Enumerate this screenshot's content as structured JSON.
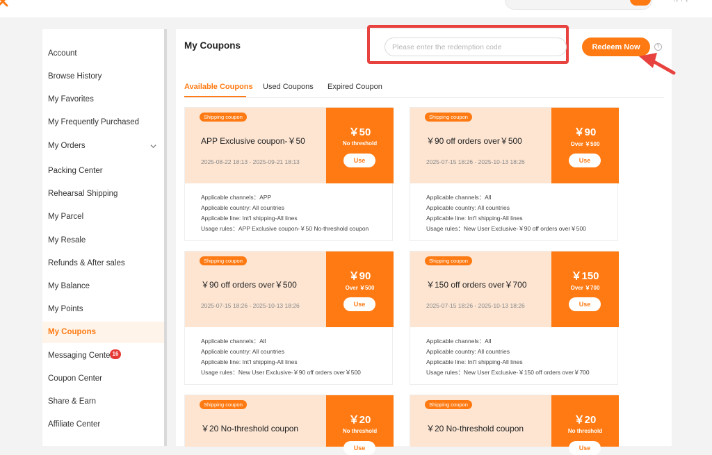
{
  "topbar": {
    "brand_icon": "logo-icon",
    "mini_text": "· · ↑↓ ↑ ↓"
  },
  "sidebar": {
    "items": [
      {
        "label": "Account"
      },
      {
        "label": "Browse History"
      },
      {
        "label": "My Favorites"
      },
      {
        "label": "My Frequently Purchased"
      },
      {
        "label": "My Orders",
        "has_chevron": true
      },
      {
        "label": "Packing Center"
      },
      {
        "label": "Rehearsal Shipping"
      },
      {
        "label": "My Parcel"
      },
      {
        "label": "My Resale"
      },
      {
        "label": "Refunds & After sales"
      },
      {
        "label": "My Balance"
      },
      {
        "label": "My Points"
      },
      {
        "label": "My Coupons",
        "active": true
      },
      {
        "label": "Messaging Center",
        "badge": "16"
      },
      {
        "label": "Coupon Center"
      },
      {
        "label": "Share & Earn"
      },
      {
        "label": "Affiliate Center"
      }
    ]
  },
  "main": {
    "title": "My Coupons",
    "redeem_placeholder": "Please enter the redemption code",
    "redeem_button": "Redeem Now",
    "help_symbol": "?",
    "tabs": [
      {
        "label": "Available Coupons",
        "active": true
      },
      {
        "label": "Used Coupons"
      },
      {
        "label": "Expired Coupon"
      }
    ],
    "coupons": [
      {
        "tag": "Shipping coupon",
        "title": "APP Exclusive coupon-￥50",
        "date": "2025-08-22 18:13 - 2025-09-21 18:13",
        "amount": "￥50",
        "condition": "No threshold",
        "use": "Use",
        "lines": [
          "Applicable channels：APP",
          "Applicable country: All countries",
          "Applicable line: Int'l shipping-All lines",
          "Usage rules：APP Exclusive coupon-￥50 No-threshold coupon"
        ]
      },
      {
        "tag": "Shipping coupon",
        "title": "￥90 off orders over￥500",
        "date": "2025-07-15 18:26 - 2025-10-13 18:26",
        "amount": "￥90",
        "condition": "Over ￥500",
        "use": "Use",
        "lines": [
          "Applicable channels：All",
          "Applicable country: All countries",
          "Applicable line: Int'l shipping-All lines",
          "Usage rules：New User Exclusive-￥90 off orders over￥500"
        ]
      },
      {
        "tag": "Shipping coupon",
        "title": "￥90 off orders over￥500",
        "date": "2025-07-15 18:26 - 2025-10-13 18:26",
        "amount": "￥90",
        "condition": "Over ￥500",
        "use": "Use",
        "lines": [
          "Applicable channels：All",
          "Applicable country: All countries",
          "Applicable line: Int'l shipping-All lines",
          "Usage rules：New User Exclusive-￥90 off orders over￥500"
        ]
      },
      {
        "tag": "Shipping coupon",
        "title": "￥150 off orders over￥700",
        "date": "2025-07-15 18:26 - 2025-10-13 18:26",
        "amount": "￥150",
        "condition": "Over ￥700",
        "use": "Use",
        "lines": [
          "Applicable channels：All",
          "Applicable country: All countries",
          "Applicable line: Int'l shipping-All lines",
          "Usage rules：New User Exclusive-￥150 off orders over￥700"
        ]
      },
      {
        "tag": "Shipping coupon",
        "title": "￥20 No-threshold coupon",
        "date": "",
        "amount": "￥20",
        "condition": "No threshold",
        "use": "Use",
        "lines": []
      },
      {
        "tag": "Shipping coupon",
        "title": "￥20 No-threshold coupon",
        "date": "",
        "amount": "￥20",
        "condition": "No threshold",
        "use": "Use",
        "lines": []
      }
    ]
  },
  "colors": {
    "accent": "#ff7a12",
    "coupon_bg": "#fde5d2",
    "highlight": "#e8423f",
    "badge": "#e53935"
  }
}
